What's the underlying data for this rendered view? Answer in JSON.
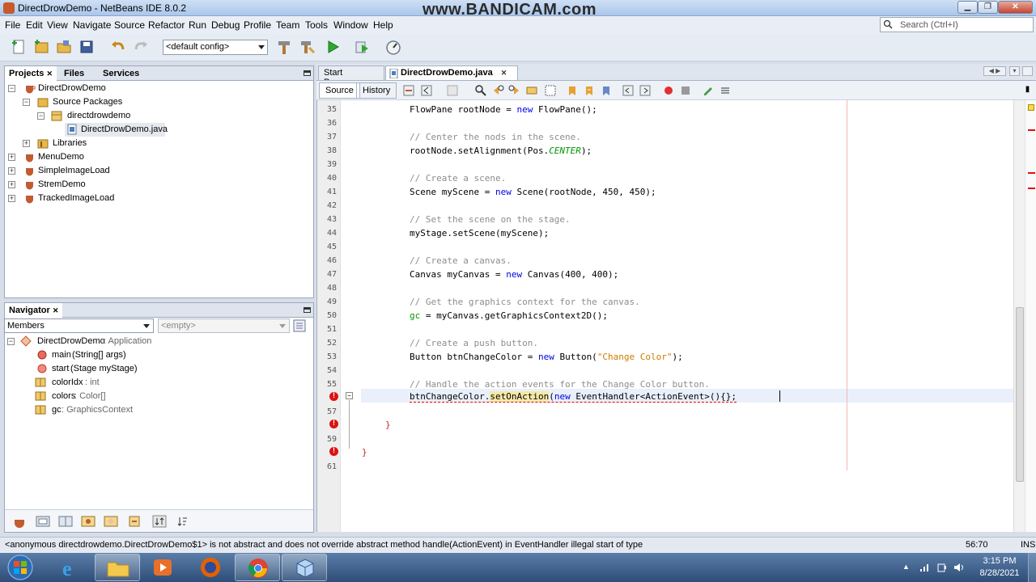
{
  "window": {
    "title": "DirectDrowDemo - NetBeans IDE 8.0.2",
    "watermark": "www.BANDICAM.com"
  },
  "menu": [
    "File",
    "Edit",
    "View",
    "Navigate",
    "Source",
    "Refactor",
    "Run",
    "Debug",
    "Profile",
    "Team",
    "Tools",
    "Window",
    "Help"
  ],
  "search": {
    "placeholder": "Search (Ctrl+I)"
  },
  "toolbar": {
    "config": "<default config>"
  },
  "projects_panel": {
    "tabs": [
      "Projects",
      "Files",
      "Services"
    ],
    "tree": [
      {
        "label": "DirectDrowDemo"
      },
      {
        "label": "Source Packages"
      },
      {
        "label": "directdrowdemo"
      },
      {
        "label": "DirectDrowDemo.java"
      },
      {
        "label": "Libraries"
      },
      {
        "label": "MenuDemo"
      },
      {
        "label": "SimpleImageLoad"
      },
      {
        "label": "StremDemo"
      },
      {
        "label": "TrackedImageLoad"
      }
    ]
  },
  "navigator": {
    "title": "Navigator",
    "filter": "Members",
    "filter2": "<empty>",
    "items": [
      {
        "name": "DirectDrowDemo",
        "type": " :: Application"
      },
      {
        "name": "main",
        "type": "(String[] args)"
      },
      {
        "name": "start",
        "type": "(Stage myStage)"
      },
      {
        "name": "colorIdx",
        "type": " : int"
      },
      {
        "name": "colors",
        "type": " : Color[]"
      },
      {
        "name": "gc",
        "type": " : GraphicsContext"
      }
    ]
  },
  "editor": {
    "tabs": [
      "Start Page",
      "DirectDrowDemo.java"
    ],
    "source_label": "Source",
    "history_label": "History",
    "line_numbers": [
      "35",
      "36",
      "37",
      "38",
      "39",
      "40",
      "41",
      "42",
      "43",
      "44",
      "45",
      "46",
      "47",
      "48",
      "49",
      "50",
      "51",
      "52",
      "53",
      "54",
      "55",
      "56",
      "57",
      "58",
      "59",
      "60",
      "61"
    ]
  },
  "status": {
    "message": "<anonymous directdrowdemo.DirectDrowDemo$1> is not abstract and does not override abstract method handle(ActionEvent) in EventHandler  illegal start of type",
    "position": "56:70",
    "mode": "INS"
  },
  "taskbar": {
    "time": "3:15 PM",
    "date": "8/28/2021"
  }
}
